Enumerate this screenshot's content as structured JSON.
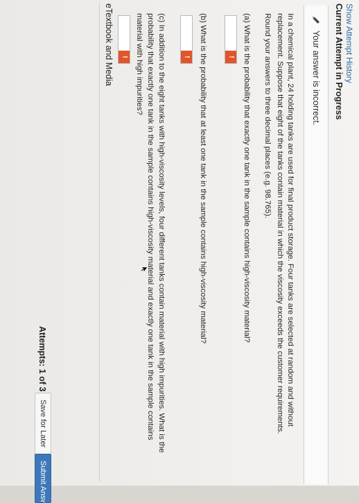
{
  "header": {
    "history_link": "Show Attempt History",
    "current_attempt": "Current Attempt in Progress"
  },
  "feedback": {
    "status": "Your answer is incorrect."
  },
  "question": {
    "intro_line1": "In a chemical plant, 24 holding tanks are used for final product storage. Four tanks are selected at random and without",
    "intro_line2": "replacement. Suppose that eight of the tanks contain material in which the viscosity exceeds the customer requirements.",
    "intro_line3": "Round your answers to three decimal places (e.g. 98.765).",
    "part_a": "(a) What is the probability that exactly one tank in the sample contains high-viscosity material?",
    "part_b": "(b) What is the probability that at least one tank in the sample contains high-viscosity material?",
    "part_c_line1": "(c) In addition to the eight tanks with high-viscosity levels, four different tanks contain material with high impurities. What is the",
    "part_c_line2": "probability that exactly one tank in the sample contains high-viscosity material and exactly one tank in the sample contains",
    "part_c_line3": "material with high impurities?"
  },
  "answers": {
    "a_value": "",
    "b_value": "",
    "c_value": "",
    "error_mark": "!"
  },
  "footer": {
    "etextbook": "eTextbook and Media",
    "attempts": "Attempts: 1 of 3 used",
    "save_label": "Save for Later",
    "submit_label": "Submit Answer"
  },
  "colors": {
    "accent": "#3d78b8",
    "error": "#e0562c"
  }
}
